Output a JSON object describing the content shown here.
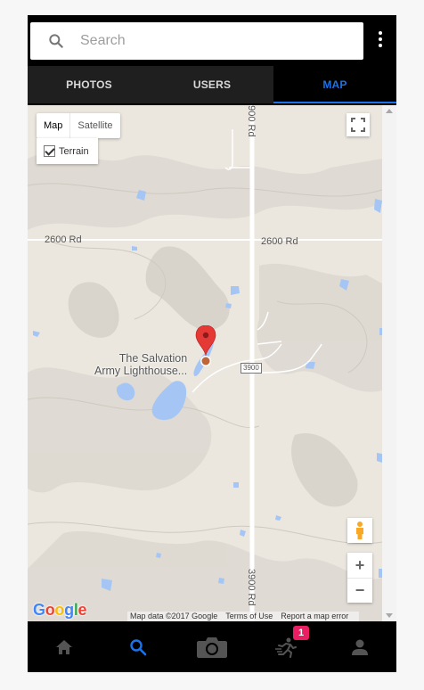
{
  "search": {
    "placeholder": "Search",
    "value": ""
  },
  "tabs": [
    {
      "label": "PHOTOS",
      "active": false
    },
    {
      "label": "USERS",
      "active": false
    },
    {
      "label": "MAP",
      "active": true
    }
  ],
  "map": {
    "map_type": {
      "map_label": "Map",
      "satellite_label": "Satellite",
      "selected": "Map"
    },
    "terrain": {
      "label": "Terrain",
      "checked": true
    },
    "road_labels": {
      "road_2600_left": "2600 Rd",
      "road_2600_right": "2600 Rd",
      "road_3900_top": "3900 Rd",
      "road_3900_bottom": "3900 Rd",
      "shield_3900": "3900"
    },
    "place": {
      "line1": "The Salvation",
      "line2": "Army Lighthouse..."
    },
    "marker_color": "#e53935",
    "water_color": "#a5c6f5",
    "land_color": "#ebe7df",
    "google_logo": "Google",
    "attribution": {
      "map_data": "Map data ©2017 Google",
      "terms": "Terms of Use",
      "report": "Report a map error"
    },
    "zoom": {
      "in": "+",
      "out": "−"
    }
  },
  "bottom_nav": {
    "items": [
      {
        "icon": "home-icon",
        "active": false
      },
      {
        "icon": "search-icon",
        "active": true
      },
      {
        "icon": "camera-icon",
        "active": false
      },
      {
        "icon": "running-person-icon",
        "active": false
      },
      {
        "icon": "person-icon",
        "active": false
      }
    ],
    "badge": "1",
    "active_color": "#1a73e8",
    "inactive_color": "#545454"
  }
}
